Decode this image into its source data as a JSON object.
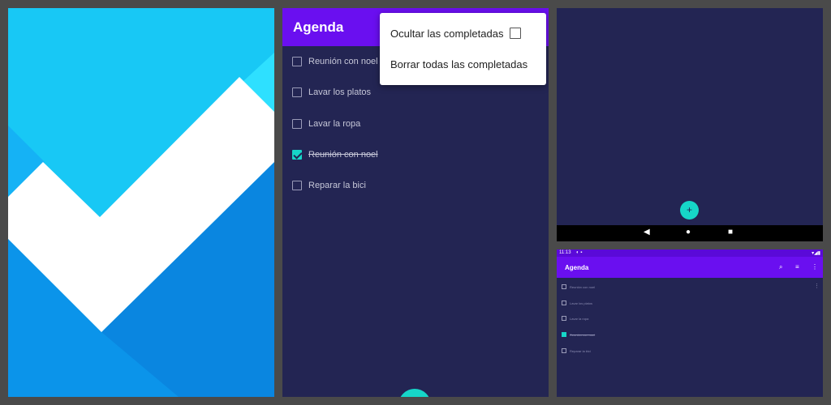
{
  "app": {
    "title": "Agenda"
  },
  "tasks": [
    {
      "label": "Reunión con noel",
      "done": false
    },
    {
      "label": "Lavar los platos",
      "done": false
    },
    {
      "label": "Lavar la ropa",
      "done": false
    },
    {
      "label": "Reunión con noel",
      "done": true
    },
    {
      "label": "Reparar la bici",
      "done": false
    }
  ],
  "menu": {
    "hide_completed": "Ocultar las completadas",
    "delete_completed": "Borrar todas las completadas"
  },
  "fab": {
    "label": "+"
  },
  "status_bar": {
    "time": "11:13"
  },
  "colors": {
    "primary": "#6a0ff0",
    "background": "#232553",
    "accent": "#16d6c8",
    "logo_light": "#18c8f5",
    "logo_dark": "#0a86e0"
  }
}
